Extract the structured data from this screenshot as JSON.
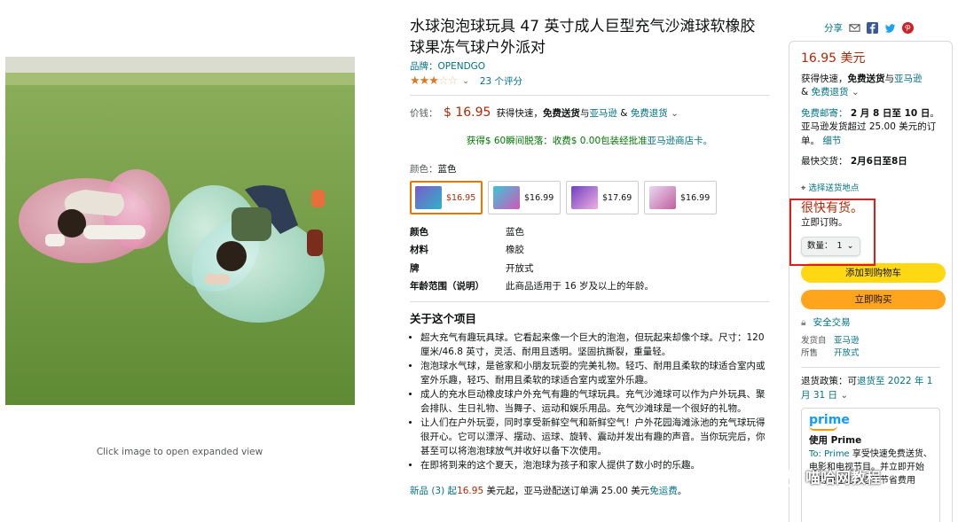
{
  "product": {
    "title": "水球泡泡球玩具 47 英寸成人巨型充气沙滩球软橡胶球果冻气球户外派对",
    "brand": "品牌：OPENDGO",
    "rating_chevron": "⌄",
    "reviews": "23 个评分",
    "image_caption": "Click image to open expanded view"
  },
  "price": {
    "label": "价钱：",
    "value": "$ 16.95",
    "shipping_prefix": "获得快速，",
    "shipping_bold": "免费送货",
    "shipping_with": "与",
    "amazon": "亚马逊",
    "amp": " & ",
    "free_returns": "免费退货",
    "chevron": "⌄"
  },
  "promo": {
    "text": "获得$ 60瞬间脱落：收费$ 0.00包装经批准",
    "link": "亚马逊商店卡。"
  },
  "color": {
    "label": "颜色：",
    "selected": "蓝色",
    "swatches": [
      {
        "price": "$16.95",
        "colors": [
          "#7a5cc8",
          "#2fb1c9"
        ]
      },
      {
        "price": "$16.99",
        "colors": [
          "#3ec4d9",
          "#d158b8"
        ]
      },
      {
        "price": "$17.69",
        "colors": [
          "#7040c0",
          "#f0b0e0"
        ]
      },
      {
        "price": "$16.99",
        "colors": [
          "#e8d8f0",
          "#c060a0"
        ]
      }
    ]
  },
  "attributes": [
    {
      "key": "颜色",
      "value": "蓝色"
    },
    {
      "key": "材料",
      "value": "橡胶"
    },
    {
      "key": "牌",
      "value": "开放式"
    },
    {
      "key": "年龄范围（说明）",
      "value": "此商品适用于 16 岁及以上的年龄。"
    }
  ],
  "about": {
    "title": "关于这个项目",
    "bullets": [
      "超大充气有趣玩具球。它看起来像一个巨大的泡泡，但玩起来却像个球。尺寸：120 厘米/46.8 英寸，灵活、耐用且透明。坚固抗撕裂，重量轻。",
      "泡泡球水气球，是爸家和小朋友玩耍的完美礼物。轻巧、耐用且柔软的球适合室内或室外乐趣，轻巧、耐用且柔软的球适合室内或室外乐趣。",
      "成人的充水巨动橡皮球户外充气有趣的气球玩具。充气沙滩球可以作为户外玩具、聚会排队、生日礼物、当舞子、运动和娱乐用品。充气沙滩球是一个很好的礼物。",
      "让人们在户外玩耍，同时享受新鲜空气和新鲜空气！户外花园海滩泳池的充气球玩得很开心。它可以漂浮、摆动、运球、旋转、震动并发出有趣的声音。当你玩完后，你甚至可以将泡泡球放气并收好以备下次使用。",
      "在即将到来的这个夏天，泡泡球为孩子和家人提供了数小时的乐趣。"
    ]
  },
  "new_offers": {
    "link": "新品 (3) 起",
    "price": "16.95",
    "text1": " 美元起，亚马逊配送订单满 25.00 美元",
    "link2": "免运费",
    "text2": "。"
  },
  "share": {
    "label": "分享"
  },
  "buybox": {
    "price": "16.95 美元",
    "ship_prefix": "获得快速，",
    "ship_bold": "免费送货",
    "ship_with": "与",
    "amazon": "亚马逊",
    "amp": "& ",
    "free_returns": "免费退货",
    "chevron": "⌄",
    "free_ship_label": "免费邮寄：",
    "free_ship_dates": "2 月 8 日至 10 日",
    "free_ship_note": "。亚马逊发货超过 25.00 美元的订单。",
    "details": "细节",
    "fastest_label": "最快交货：",
    "fastest_dates": "2月6日至8日",
    "location": "选择送货地点",
    "in_stock": "很快有货。",
    "order_now": "立即订购。",
    "qty_label": "数量：",
    "qty_value": "1",
    "add_to_cart": "添加到购物车",
    "buy_now": "立即购买",
    "secure": "安全交易",
    "ships_from_label": "发货自",
    "ships_from": "亚马逊",
    "sold_by_label": "所售",
    "sold_by": "开放式",
    "return_prefix": "退货政策：可",
    "return_link": "退货至 2022 年 1 月 31 日",
    "prime_logo": "prime",
    "prime_use": "使用 Prime",
    "prime_text_link": "To: Prime",
    "prime_text": "享受快速免费送货、电影和电视节目。",
    "prime_text2": "并立即开始使用快速免费送货节省费用"
  },
  "watermark": {
    "text": "喵哈网教程"
  },
  "colors": {
    "price": "#b12704",
    "link": "#007185",
    "cart": "#ffd814",
    "buy": "#ffa41c",
    "stock_border": "#e21b1b"
  }
}
